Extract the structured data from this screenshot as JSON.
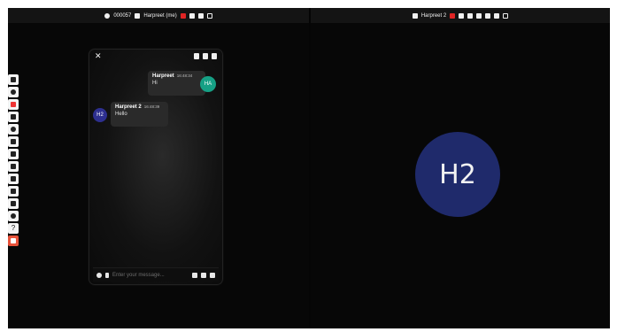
{
  "left_header": {
    "code": "000057",
    "user": "Harpreet (me)"
  },
  "right_header": {
    "user": "Harpreet 2"
  },
  "toolbar": {
    "items": [
      {
        "icon": "participants-icon"
      },
      {
        "icon": "microphone-icon"
      },
      {
        "icon": "camera-off-icon"
      },
      {
        "icon": "screen-share-icon"
      },
      {
        "icon": "settings-icon"
      },
      {
        "icon": "fullscreen-icon"
      },
      {
        "icon": "mute-audio-icon"
      },
      {
        "icon": "chat-icon"
      },
      {
        "icon": "hand-raise-icon"
      },
      {
        "icon": "whiteboard-icon"
      },
      {
        "icon": "files-icon"
      },
      {
        "icon": "settings-gear-icon"
      },
      {
        "icon": "help-icon",
        "label": "?"
      },
      {
        "icon": "leave-call-icon"
      }
    ]
  },
  "chat": {
    "messages": [
      {
        "sender": "Harpreet",
        "time": "16:48:34",
        "text": "Hi",
        "avatar": "HA",
        "avatar_color": "#16a085"
      },
      {
        "sender": "Harpreet 2",
        "time": "16:48:39",
        "text": "Hello",
        "avatar": "H2",
        "avatar_color": "#2d2f8f"
      }
    ],
    "input_placeholder": "Enter your message..."
  },
  "remote": {
    "avatar": "H2",
    "avatar_color": "#1f2a6b"
  }
}
